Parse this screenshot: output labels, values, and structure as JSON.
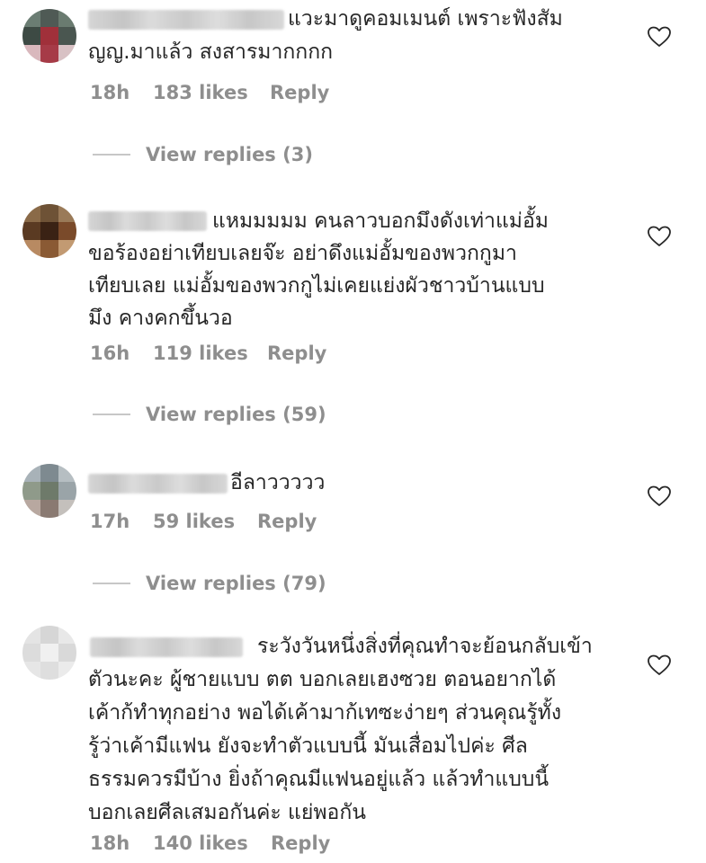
{
  "comments": [
    {
      "text_lines": [
        "แวะมาดูคอมเมนต์ เพราะฟังสัม",
        "ญญ.มาแล้ว สงสารมากกกก"
      ],
      "time": "18h",
      "likes": "183 likes",
      "reply": "Reply",
      "view_replies": "View replies (3)",
      "avatar_colors": [
        "#6b7d73",
        "#4f5a55",
        "#6a7b70",
        "#3d4a44",
        "#a0303a",
        "#4a5650",
        "#d9b8bd",
        "#a63b47",
        "#d8c1c4"
      ]
    },
    {
      "text_lines": [
        "แหมมมมม คนลาวบอกมึงดังเท่าแม่อั้ม",
        "ขอร้องอย่าเทียบเลยจ๊ะ อย่าดึงแม่อั้มของพวกกูมา",
        "เทียบเลย แม่อั้มของพวกกูไม่เคยแย่งผัวชาวบ้านแบบ",
        "มึง คางคกขึ้นวอ"
      ],
      "time": "16h",
      "likes": "119 likes",
      "reply": "Reply",
      "view_replies": "View replies (59)",
      "avatar_colors": [
        "#8a6a48",
        "#6e5236",
        "#9a7a58",
        "#5a3a22",
        "#3a2214",
        "#7a4a2a",
        "#b88a62",
        "#8a5a34",
        "#c29a72"
      ]
    },
    {
      "text_lines": [
        "อีลาววววว"
      ],
      "time": "17h",
      "likes": "59 likes",
      "reply": "Reply",
      "view_replies": "View replies (79)",
      "avatar_colors": [
        "#a8b2b8",
        "#7e8a90",
        "#b6bec2",
        "#8f9a8a",
        "#6e7a6a",
        "#9aa4a8",
        "#b8a8a0",
        "#8a7a72",
        "#c4c0bc"
      ]
    },
    {
      "text_lines": [
        "ระวังวันหนึ่งสิ่งที่คุณทำจะย้อนกลับเข้า",
        "ตัวนะคะ ผู้ชายแบบ ตต บอกเลยเฮงซวย ตอนอยากได้",
        "เค้าก้ทำทุกอย่าง พอได้เค้ามาก้เทซะง่ายๆ ส่วนคุณรู้ทั้ง",
        "รู้ว่าเค้ามีแฟน ยังจะทำตัวแบบนี้ มันเสื่อมไปค่ะ ศีล",
        "ธรรมควรมีบ้าง ยิ่งถ้าคุณมีแฟนอยู่แล้ว แล้วทำแบบนี้",
        "บอกเลยศีลเสมอกันค่ะ แย่พอกัน"
      ],
      "time": "18h",
      "likes": "140 likes",
      "reply": "Reply",
      "avatar_colors": [
        "#e4e4e4",
        "#d6d6d6",
        "#e8e8e8",
        "#dcdcdc",
        "#f0f0f0",
        "#d9d9d9",
        "#e6e6e6",
        "#dedede",
        "#ebebeb"
      ]
    }
  ],
  "icons": {
    "like": "heart-outline-icon"
  },
  "colors": {
    "text": "#262626",
    "secondary": "#8e8e8e",
    "divider": "#c7c7c7"
  }
}
